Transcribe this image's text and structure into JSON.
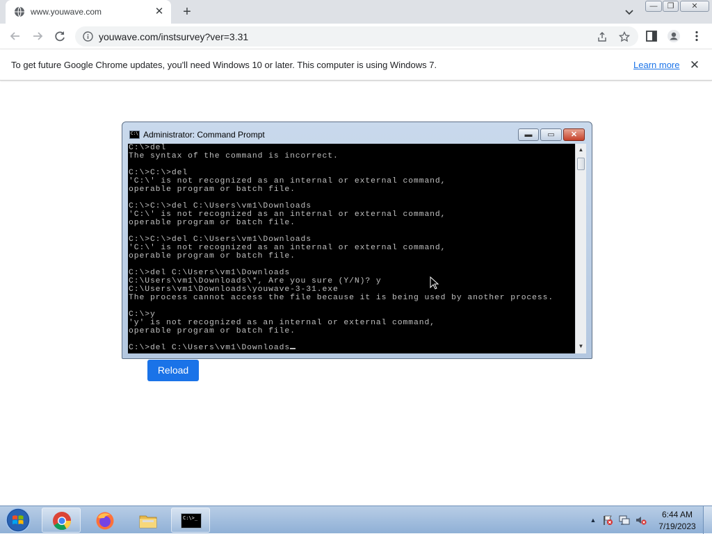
{
  "browser": {
    "tab": {
      "title": "www.youwave.com",
      "close_glyph": "✕",
      "favicon": "globe-icon"
    },
    "new_tab_glyph": "+",
    "window_controls": {
      "minimize": "—",
      "restore": "❐",
      "close": "✕"
    },
    "address": {
      "url": "youwave.com/instsurvey?ver=3.31"
    },
    "infobar": {
      "message": "To get future Google Chrome updates, you'll need Windows 10 or later. This computer is using Windows 7.",
      "link": "Learn more",
      "close_glyph": "✕"
    }
  },
  "page": {
    "reload_button": "Reload"
  },
  "cmd": {
    "title": "Administrator:  Command Prompt",
    "icon_text": "C:\\",
    "lines": [
      "C:\\>del",
      "The syntax of the command is incorrect.",
      "",
      "C:\\>C:\\>del",
      "'C:\\' is not recognized as an internal or external command,",
      "operable program or batch file.",
      "",
      "C:\\>C:\\>del C:\\Users\\vm1\\Downloads",
      "'C:\\' is not recognized as an internal or external command,",
      "operable program or batch file.",
      "",
      "C:\\>C:\\>del C:\\Users\\vm1\\Downloads",
      "'C:\\' is not recognized as an internal or external command,",
      "operable program or batch file.",
      "",
      "C:\\>del C:\\Users\\vm1\\Downloads",
      "C:\\Users\\vm1\\Downloads\\*, Are you sure (Y/N)? y",
      "C:\\Users\\vm1\\Downloads\\youwave-3-31.exe",
      "The process cannot access the file because it is being used by another process.",
      "",
      "C:\\>y",
      "'y' is not recognized as an internal or external command,",
      "operable program or batch file.",
      "",
      "C:\\>del C:\\Users\\vm1\\Downloads"
    ],
    "controls": {
      "minimize": "▬",
      "maximize": "▭",
      "close": "✕"
    },
    "scroll": {
      "up": "▲",
      "down": "▼"
    }
  },
  "taskbar": {
    "apps": [
      "chrome-icon",
      "firefox-icon",
      "explorer-icon",
      "cmd-icon"
    ],
    "cmd_icon_text": "C:\\>_",
    "tray": {
      "time": "6:44 AM",
      "date": "7/19/2023",
      "show_hidden": "▲"
    }
  },
  "colors": {
    "accent": "#1a73e8",
    "console_bg": "#000000",
    "console_fg": "#c0c0c0",
    "taskbar": "#a9c3e3"
  }
}
